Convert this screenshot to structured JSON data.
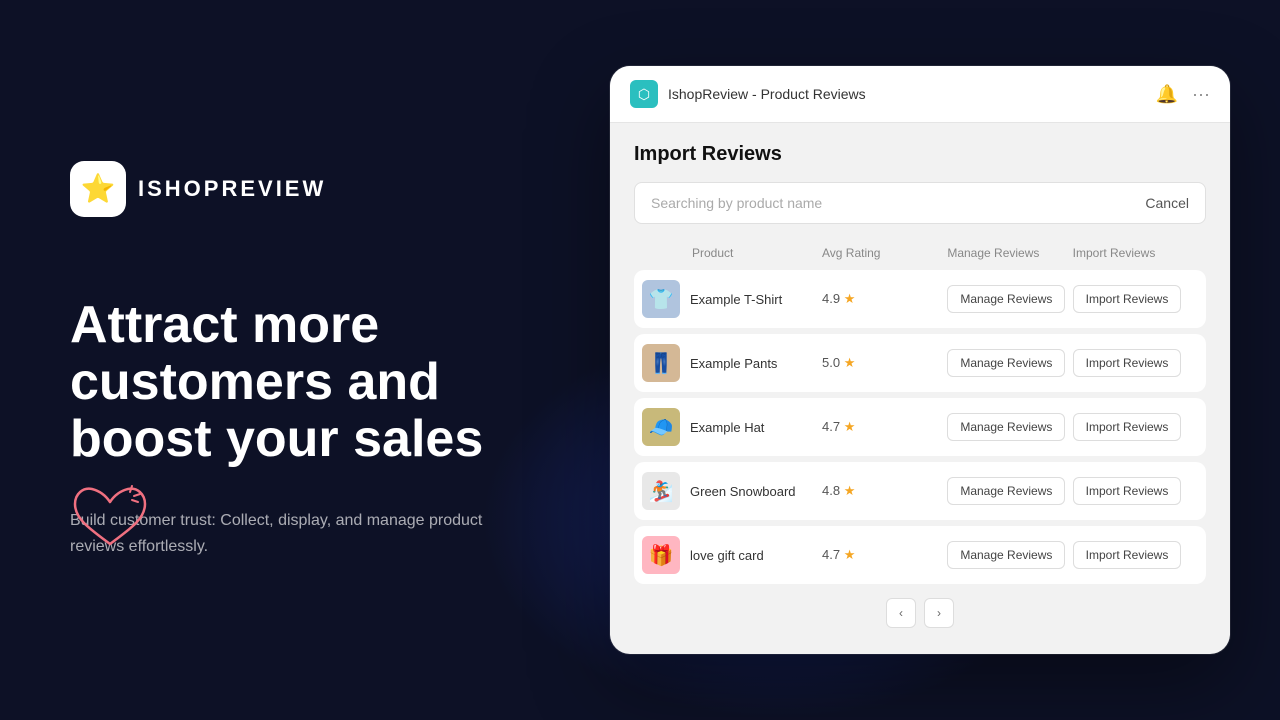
{
  "brand": {
    "logo_emoji": "⭐",
    "name": "ISHOPREVIEW"
  },
  "hero": {
    "headline": "Attract more customers and boost your sales",
    "subtext": "Build customer trust: Collect, display, and manage product reviews effortlessly."
  },
  "app_window": {
    "title": "IshopReview - Product Reviews",
    "page_title": "Import Reviews",
    "search_placeholder": "Searching by product name",
    "cancel_label": "Cancel",
    "table": {
      "headers": [
        "Product",
        "Avg Rating",
        "Manage Reviews",
        "Import Reviews"
      ],
      "rows": [
        {
          "name": "Example T-Shirt",
          "rating": "4.9",
          "thumb_class": "thumb-tshirt",
          "thumb_emoji": "👕"
        },
        {
          "name": "Example Pants",
          "rating": "5.0",
          "thumb_class": "thumb-pants",
          "thumb_emoji": "👖"
        },
        {
          "name": "Example Hat",
          "rating": "4.7",
          "thumb_class": "thumb-hat",
          "thumb_emoji": "🧢"
        },
        {
          "name": "Green Snowboard",
          "rating": "4.8",
          "thumb_class": "thumb-snowboard",
          "thumb_emoji": "🏂"
        },
        {
          "name": "love gift card",
          "rating": "4.7",
          "thumb_class": "thumb-gift",
          "thumb_emoji": "🎁"
        }
      ],
      "manage_label": "Manage Reviews",
      "import_label": "Import Reviews"
    },
    "pagination": {
      "prev": "‹",
      "next": "›"
    }
  }
}
